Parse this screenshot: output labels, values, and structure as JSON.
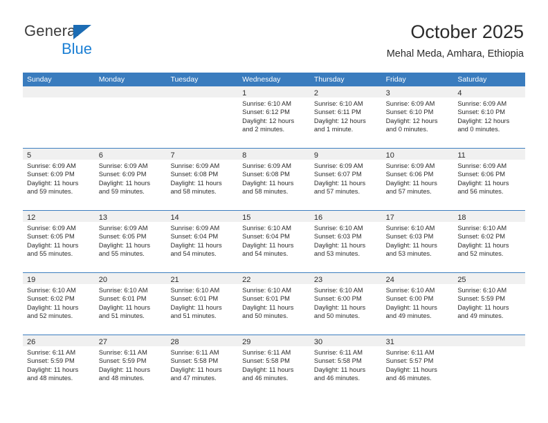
{
  "brand": {
    "name_part1": "General",
    "name_part2": "Blue",
    "triangle_color": "#1c6cb4",
    "blue_color": "#1b7fd4"
  },
  "header": {
    "title": "October 2025",
    "subtitle": "Mehal Meda, Amhara, Ethiopia"
  },
  "theme": {
    "header_bar": "#3a7cbe",
    "day_band": "#f0f0f0",
    "text": "#2b2b2b"
  },
  "calendar": {
    "weekdays": [
      "Sunday",
      "Monday",
      "Tuesday",
      "Wednesday",
      "Thursday",
      "Friday",
      "Saturday"
    ],
    "weeks": [
      [
        {
          "day": "",
          "lines": []
        },
        {
          "day": "",
          "lines": []
        },
        {
          "day": "",
          "lines": []
        },
        {
          "day": "1",
          "lines": [
            "Sunrise: 6:10 AM",
            "Sunset: 6:12 PM",
            "Daylight: 12 hours",
            "and 2 minutes."
          ]
        },
        {
          "day": "2",
          "lines": [
            "Sunrise: 6:10 AM",
            "Sunset: 6:11 PM",
            "Daylight: 12 hours",
            "and 1 minute."
          ]
        },
        {
          "day": "3",
          "lines": [
            "Sunrise: 6:09 AM",
            "Sunset: 6:10 PM",
            "Daylight: 12 hours",
            "and 0 minutes."
          ]
        },
        {
          "day": "4",
          "lines": [
            "Sunrise: 6:09 AM",
            "Sunset: 6:10 PM",
            "Daylight: 12 hours",
            "and 0 minutes."
          ]
        }
      ],
      [
        {
          "day": "5",
          "lines": [
            "Sunrise: 6:09 AM",
            "Sunset: 6:09 PM",
            "Daylight: 11 hours",
            "and 59 minutes."
          ]
        },
        {
          "day": "6",
          "lines": [
            "Sunrise: 6:09 AM",
            "Sunset: 6:09 PM",
            "Daylight: 11 hours",
            "and 59 minutes."
          ]
        },
        {
          "day": "7",
          "lines": [
            "Sunrise: 6:09 AM",
            "Sunset: 6:08 PM",
            "Daylight: 11 hours",
            "and 58 minutes."
          ]
        },
        {
          "day": "8",
          "lines": [
            "Sunrise: 6:09 AM",
            "Sunset: 6:08 PM",
            "Daylight: 11 hours",
            "and 58 minutes."
          ]
        },
        {
          "day": "9",
          "lines": [
            "Sunrise: 6:09 AM",
            "Sunset: 6:07 PM",
            "Daylight: 11 hours",
            "and 57 minutes."
          ]
        },
        {
          "day": "10",
          "lines": [
            "Sunrise: 6:09 AM",
            "Sunset: 6:06 PM",
            "Daylight: 11 hours",
            "and 57 minutes."
          ]
        },
        {
          "day": "11",
          "lines": [
            "Sunrise: 6:09 AM",
            "Sunset: 6:06 PM",
            "Daylight: 11 hours",
            "and 56 minutes."
          ]
        }
      ],
      [
        {
          "day": "12",
          "lines": [
            "Sunrise: 6:09 AM",
            "Sunset: 6:05 PM",
            "Daylight: 11 hours",
            "and 55 minutes."
          ]
        },
        {
          "day": "13",
          "lines": [
            "Sunrise: 6:09 AM",
            "Sunset: 6:05 PM",
            "Daylight: 11 hours",
            "and 55 minutes."
          ]
        },
        {
          "day": "14",
          "lines": [
            "Sunrise: 6:09 AM",
            "Sunset: 6:04 PM",
            "Daylight: 11 hours",
            "and 54 minutes."
          ]
        },
        {
          "day": "15",
          "lines": [
            "Sunrise: 6:10 AM",
            "Sunset: 6:04 PM",
            "Daylight: 11 hours",
            "and 54 minutes."
          ]
        },
        {
          "day": "16",
          "lines": [
            "Sunrise: 6:10 AM",
            "Sunset: 6:03 PM",
            "Daylight: 11 hours",
            "and 53 minutes."
          ]
        },
        {
          "day": "17",
          "lines": [
            "Sunrise: 6:10 AM",
            "Sunset: 6:03 PM",
            "Daylight: 11 hours",
            "and 53 minutes."
          ]
        },
        {
          "day": "18",
          "lines": [
            "Sunrise: 6:10 AM",
            "Sunset: 6:02 PM",
            "Daylight: 11 hours",
            "and 52 minutes."
          ]
        }
      ],
      [
        {
          "day": "19",
          "lines": [
            "Sunrise: 6:10 AM",
            "Sunset: 6:02 PM",
            "Daylight: 11 hours",
            "and 52 minutes."
          ]
        },
        {
          "day": "20",
          "lines": [
            "Sunrise: 6:10 AM",
            "Sunset: 6:01 PM",
            "Daylight: 11 hours",
            "and 51 minutes."
          ]
        },
        {
          "day": "21",
          "lines": [
            "Sunrise: 6:10 AM",
            "Sunset: 6:01 PM",
            "Daylight: 11 hours",
            "and 51 minutes."
          ]
        },
        {
          "day": "22",
          "lines": [
            "Sunrise: 6:10 AM",
            "Sunset: 6:01 PM",
            "Daylight: 11 hours",
            "and 50 minutes."
          ]
        },
        {
          "day": "23",
          "lines": [
            "Sunrise: 6:10 AM",
            "Sunset: 6:00 PM",
            "Daylight: 11 hours",
            "and 50 minutes."
          ]
        },
        {
          "day": "24",
          "lines": [
            "Sunrise: 6:10 AM",
            "Sunset: 6:00 PM",
            "Daylight: 11 hours",
            "and 49 minutes."
          ]
        },
        {
          "day": "25",
          "lines": [
            "Sunrise: 6:10 AM",
            "Sunset: 5:59 PM",
            "Daylight: 11 hours",
            "and 49 minutes."
          ]
        }
      ],
      [
        {
          "day": "26",
          "lines": [
            "Sunrise: 6:11 AM",
            "Sunset: 5:59 PM",
            "Daylight: 11 hours",
            "and 48 minutes."
          ]
        },
        {
          "day": "27",
          "lines": [
            "Sunrise: 6:11 AM",
            "Sunset: 5:59 PM",
            "Daylight: 11 hours",
            "and 48 minutes."
          ]
        },
        {
          "day": "28",
          "lines": [
            "Sunrise: 6:11 AM",
            "Sunset: 5:58 PM",
            "Daylight: 11 hours",
            "and 47 minutes."
          ]
        },
        {
          "day": "29",
          "lines": [
            "Sunrise: 6:11 AM",
            "Sunset: 5:58 PM",
            "Daylight: 11 hours",
            "and 46 minutes."
          ]
        },
        {
          "day": "30",
          "lines": [
            "Sunrise: 6:11 AM",
            "Sunset: 5:58 PM",
            "Daylight: 11 hours",
            "and 46 minutes."
          ]
        },
        {
          "day": "31",
          "lines": [
            "Sunrise: 6:11 AM",
            "Sunset: 5:57 PM",
            "Daylight: 11 hours",
            "and 46 minutes."
          ]
        },
        {
          "day": "",
          "lines": []
        }
      ]
    ]
  }
}
